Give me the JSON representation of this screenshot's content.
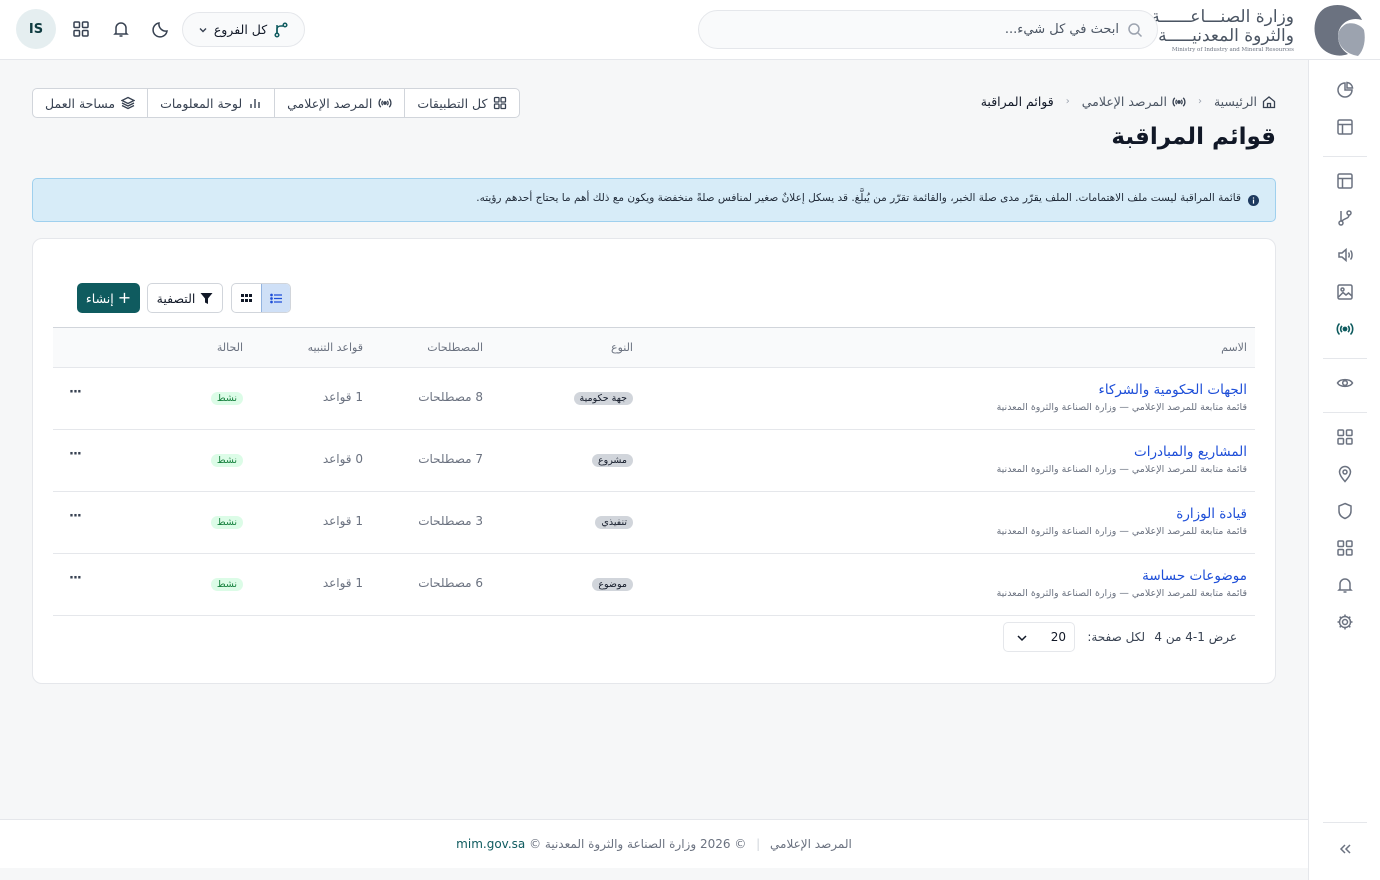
{
  "header": {
    "logo": {
      "line1": "وزارة الصنـــاعــــــة",
      "line2": "والثروة المعدنيـــــة",
      "line3": "Ministry of Industry and Mineral Resources"
    },
    "search_placeholder": "ابحث في كل شيء...",
    "branch_label": "كل الفروع",
    "avatar_initials": "IS"
  },
  "toolbar": {
    "items": [
      {
        "label": "مساحة العمل",
        "icon": "layers-icon"
      },
      {
        "label": "لوحة المعلومات",
        "icon": "bar-chart-icon"
      },
      {
        "label": "المرصد الإعلامي",
        "icon": "broadcast-icon"
      },
      {
        "label": "كل التطبيقات",
        "icon": "grid-icon"
      }
    ]
  },
  "breadcrumb": {
    "home": "الرئيسية",
    "section": "المرصد الإعلامي",
    "current": "قوائم المراقبة"
  },
  "page_title": "قوائم المراقبة",
  "alert": {
    "text": "قائمة المراقبة ليست ملف الاهتمامات. الملف يقرّر مدى صلة الخبر، والقائمة تقرّر من يُبلَّغ. قد يسكل إعلانٌ صغير لمنافس صلةً منخفضة ويكون مع ذلك أهم ما يحتاج أحدهم رؤيته."
  },
  "actions": {
    "create": "إنشاء",
    "filter": "التصفية"
  },
  "table": {
    "headers": {
      "name": "الاسم",
      "type": "النوع",
      "terms": "المصطلحات",
      "rules": "قواعد التنبيه",
      "status": "الحالة"
    },
    "rows": [
      {
        "name": "الجهات الحكومية والشركاء",
        "subtitle": "قائمة متابعة للمرصد الإعلامي — وزارة الصناعة والثروة المعدنية",
        "type": "جهة حكومية",
        "terms": "8 مصطلحات",
        "rules": "1 قواعد",
        "status": "نشط",
        "more": "···"
      },
      {
        "name": "المشاريع والمبادرات",
        "subtitle": "قائمة متابعة للمرصد الإعلامي — وزارة الصناعة والثروة المعدنية",
        "type": "مشروع",
        "terms": "7 مصطلحات",
        "rules": "0 قواعد",
        "status": "نشط",
        "more": "···"
      },
      {
        "name": "قيادة الوزارة",
        "subtitle": "قائمة متابعة للمرصد الإعلامي — وزارة الصناعة والثروة المعدنية",
        "type": "تنفيذي",
        "terms": "3 مصطلحات",
        "rules": "1 قواعد",
        "status": "نشط",
        "more": "···"
      },
      {
        "name": "موضوعات حساسة",
        "subtitle": "قائمة متابعة للمرصد الإعلامي — وزارة الصناعة والثروة المعدنية",
        "type": "موضوع",
        "terms": "6 مصطلحات",
        "rules": "1 قواعد",
        "status": "نشط",
        "more": "···"
      }
    ]
  },
  "pagination": {
    "range": "عرض 1-4 من 4",
    "per_page_label": "لكل صفحة:",
    "per_page_value": "20"
  },
  "footer": {
    "section": "المرصد الإعلامي",
    "copyright": "© 2026 وزارة الصناعة والثروة المعدنية ©",
    "link": "mim.gov.sa",
    "separator": "|"
  },
  "colors": {
    "brand": "#0f5b5f",
    "link": "#1d4ed8",
    "alert_bg": "#d7ecf8"
  }
}
